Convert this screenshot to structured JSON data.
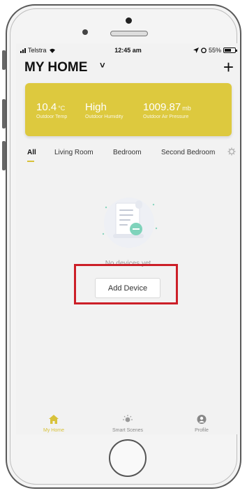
{
  "status_bar": {
    "carrier": "Telstra",
    "time": "12:45 am",
    "battery_percent": "55%"
  },
  "header": {
    "title": "MY HOME",
    "caret": "˅",
    "add_label": "+"
  },
  "weather": {
    "temperature": {
      "value": "10.4",
      "unit": "°C",
      "label": "Outdoor Temp"
    },
    "humidity": {
      "value": "High",
      "label": "Outdoor Humidity"
    },
    "pressure": {
      "value": "1009.87",
      "unit": "mb",
      "label": "Outdoor Air Pressure"
    },
    "card_color": "#ddc93e"
  },
  "tabs": [
    {
      "label": "All",
      "active": true
    },
    {
      "label": "Living Room"
    },
    {
      "label": "Bedroom"
    },
    {
      "label": "Second Bedroom"
    }
  ],
  "empty_state": {
    "message": "No devices yet",
    "button_label": "Add Device"
  },
  "bottom_nav": [
    {
      "label": "My Home",
      "icon": "home-icon",
      "active": true
    },
    {
      "label": "Smart Scenes",
      "icon": "sun-icon"
    },
    {
      "label": "Profile",
      "icon": "profile-icon"
    }
  ],
  "colors": {
    "accent": "#d8c23a",
    "highlight": "#cc1f28"
  }
}
